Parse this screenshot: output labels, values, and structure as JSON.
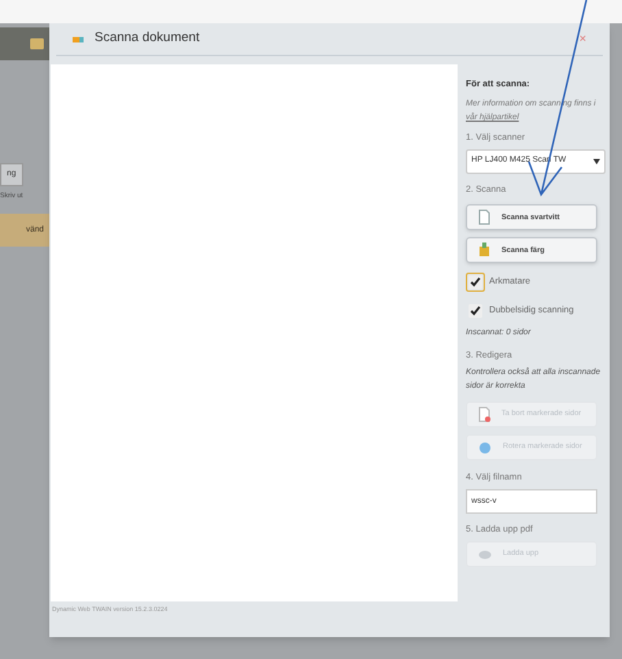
{
  "background": {
    "tab": "ng",
    "toolbar_text": "Skriv ut",
    "highlighted_row": "vänd"
  },
  "dialog": {
    "title": "Scanna dokument",
    "close": "×",
    "footer": "Dynamic Web TWAIN version 15.2.3.0224",
    "panel": {
      "heading": "För att scanna:",
      "info": "Mer information om scanning finns i",
      "info_link": "vår hjälpartikel",
      "step1": "1. Välj scanner",
      "scanner": "HP LJ400 M425 Scan TW",
      "step2": "2. Scanna",
      "scan_buttons": [
        {
          "label": "Scanna svartvitt",
          "kind": "document",
          "disabled": false
        },
        {
          "label": "Scanna färg",
          "kind": "color",
          "disabled": false
        }
      ],
      "checkboxes": [
        {
          "label": "Arkmatare",
          "checked": true,
          "focused": true
        },
        {
          "label": "Dubbelsidig scanning",
          "checked": true,
          "focused": false
        }
      ],
      "scanned": "Inscannat: 0 sidor",
      "step3": "3. Redigera",
      "edit_note": "Kontrollera också att alla inscannade sidor är korrekta",
      "edit_buttons": [
        {
          "label": "Ta bort markerade sidor",
          "kind": "delete",
          "disabled": true
        },
        {
          "label": "Rotera markerade sidor",
          "kind": "rotate",
          "disabled": true
        }
      ],
      "step4": "4. Välj filnamn",
      "filename": "wssc-v",
      "step5": "5. Ladda upp pdf",
      "upload": {
        "label": "Ladda upp",
        "kind": "upload",
        "disabled": true
      }
    }
  }
}
